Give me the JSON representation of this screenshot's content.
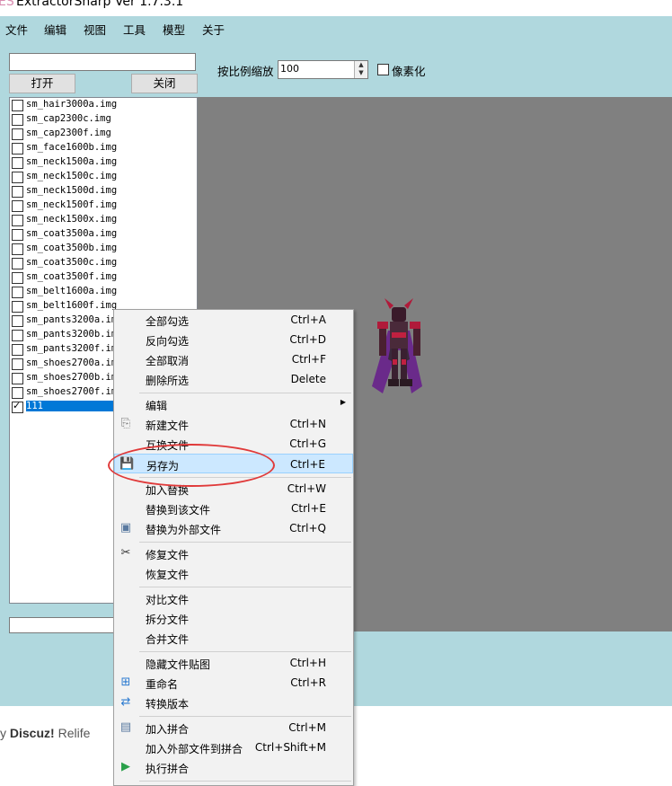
{
  "window": {
    "title": "ExtractorSharp Ver 1.7.3.1"
  },
  "menu": [
    "文件",
    "编辑",
    "视图",
    "工具",
    "模型",
    "关于"
  ],
  "buttons": {
    "open": "打开",
    "close": "关闭"
  },
  "zoom": {
    "label": "按比例缩放",
    "value": "100"
  },
  "pixelate": {
    "label": "像素化",
    "checked": false
  },
  "files": [
    {
      "name": "sm_hair3000a.img",
      "checked": false
    },
    {
      "name": "sm_cap2300c.img",
      "checked": false
    },
    {
      "name": "sm_cap2300f.img",
      "checked": false
    },
    {
      "name": "sm_face1600b.img",
      "checked": false
    },
    {
      "name": "sm_neck1500a.img",
      "checked": false
    },
    {
      "name": "sm_neck1500c.img",
      "checked": false
    },
    {
      "name": "sm_neck1500d.img",
      "checked": false
    },
    {
      "name": "sm_neck1500f.img",
      "checked": false
    },
    {
      "name": "sm_neck1500x.img",
      "checked": false
    },
    {
      "name": "sm_coat3500a.img",
      "checked": false
    },
    {
      "name": "sm_coat3500b.img",
      "checked": false
    },
    {
      "name": "sm_coat3500c.img",
      "checked": false
    },
    {
      "name": "sm_coat3500f.img",
      "checked": false
    },
    {
      "name": "sm_belt1600a.img",
      "checked": false
    },
    {
      "name": "sm_belt1600f.img",
      "checked": false
    },
    {
      "name": "sm_pants3200a.img",
      "checked": false
    },
    {
      "name": "sm_pants3200b.img",
      "checked": false
    },
    {
      "name": "sm_pants3200f.img",
      "checked": false
    },
    {
      "name": "sm_shoes2700a.img",
      "checked": false
    },
    {
      "name": "sm_shoes2700b.img",
      "checked": false
    },
    {
      "name": "sm_shoes2700f.img",
      "checked": false
    },
    {
      "name": "111",
      "checked": true,
      "selected": true
    }
  ],
  "context_menu": [
    {
      "label": "全部勾选",
      "shortcut": "Ctrl+A"
    },
    {
      "label": "反向勾选",
      "shortcut": "Ctrl+D"
    },
    {
      "label": "全部取消",
      "shortcut": "Ctrl+F"
    },
    {
      "label": "删除所选",
      "shortcut": "Delete"
    },
    {
      "sep": true
    },
    {
      "label": "编辑",
      "submenu": true
    },
    {
      "label": "新建文件",
      "shortcut": "Ctrl+N",
      "icon": "new-file-icon"
    },
    {
      "label": "互换文件",
      "shortcut": "Ctrl+G"
    },
    {
      "label": "另存为",
      "shortcut": "Ctrl+E",
      "icon": "save-icon",
      "highlighted": true
    },
    {
      "sep": true
    },
    {
      "label": "加入替换",
      "shortcut": "Ctrl+W"
    },
    {
      "label": "替换到该文件",
      "shortcut": "Ctrl+E"
    },
    {
      "label": "替换为外部文件",
      "shortcut": "Ctrl+Q",
      "icon": "image-replace-icon"
    },
    {
      "sep": true
    },
    {
      "label": "修复文件",
      "icon": "tools-icon"
    },
    {
      "label": "恢复文件"
    },
    {
      "sep": true
    },
    {
      "label": "对比文件"
    },
    {
      "label": "拆分文件"
    },
    {
      "label": "合并文件"
    },
    {
      "sep": true
    },
    {
      "label": "隐藏文件贴图",
      "shortcut": "Ctrl+H"
    },
    {
      "label": "重命名",
      "shortcut": "Ctrl+R",
      "icon": "rename-icon"
    },
    {
      "label": "转换版本",
      "icon": "convert-icon"
    },
    {
      "sep": true
    },
    {
      "label": "加入拼合",
      "shortcut": "Ctrl+M",
      "icon": "merge-file-icon"
    },
    {
      "label": "加入外部文件到拼合",
      "shortcut": "Ctrl+Shift+M"
    },
    {
      "label": "执行拼合",
      "icon": "play-icon"
    },
    {
      "sep": true
    }
  ],
  "background_text": {
    "prefix": "y ",
    "brand": "Discuz!",
    "suffix": " Relife"
  },
  "colors": {
    "client_bg": "#b0d8de",
    "canvas_bg": "#808080",
    "selection": "#0078d7",
    "menu_highlight": "#cce8ff",
    "annotation": "#e03a3a"
  }
}
